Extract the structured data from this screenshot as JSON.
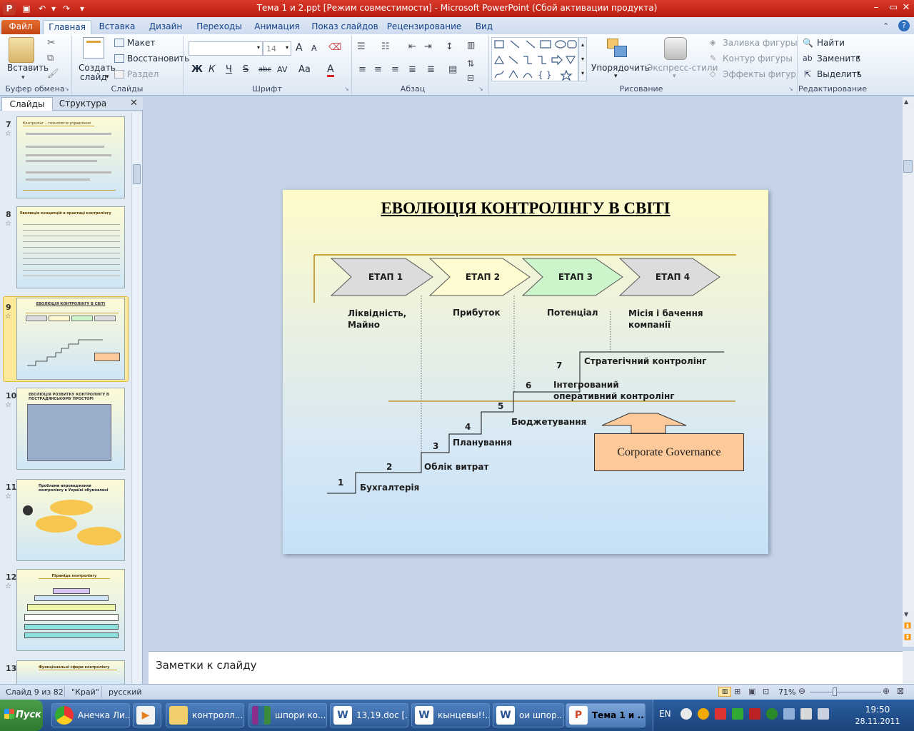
{
  "window": {
    "title": "Тема 1 и 2.ppt [Режим совместимости]  -  Microsoft PowerPoint (Сбой активации продукта)"
  },
  "ribbon_tabs": [
    "Файл",
    "Главная",
    "Вставка",
    "Дизайн",
    "Переходы",
    "Анимация",
    "Показ слайдов",
    "Рецензирование",
    "Вид"
  ],
  "ribbon": {
    "clipboard": {
      "paste": "Вставить",
      "group": "Буфер обмена"
    },
    "slides": {
      "new_slide_1": "Создать",
      "new_slide_2": "слайд",
      "layout": "Макет",
      "reset": "Восстановить",
      "section": "Раздел",
      "group": "Слайды"
    },
    "font": {
      "size": "14",
      "group": "Шрифт",
      "bold": "Ж",
      "italic": "К",
      "underline": "Ч",
      "strike": "S",
      "shadow": "abc",
      "spacing": "AV",
      "case": "Aa",
      "color": "A",
      "grow": "A",
      "shrink": "A"
    },
    "paragraph": {
      "group": "Абзац"
    },
    "drawing": {
      "arrange": "Упорядочить",
      "quick_styles": "Экспресс-стили",
      "fill": "Заливка фигуры",
      "outline": "Контур фигуры",
      "effects": "Эффекты фигур",
      "group": "Рисование"
    },
    "editing": {
      "find": "Найти",
      "replace": "Заменить",
      "select": "Выделить",
      "group": "Редактирование"
    }
  },
  "left_pane": {
    "tab_slides": "Слайды",
    "tab_outline": "Структура",
    "thumbnails": [
      {
        "num": "7",
        "title": "Контролінг – технологія управління",
        "selected": false
      },
      {
        "num": "8",
        "title": "Еволюція концепцій в практиці контролінгу",
        "selected": false
      },
      {
        "num": "9",
        "title": "ЕВОЛЮЦІЯ КОНТРОЛІНГУ В СВІТІ",
        "selected": true
      },
      {
        "num": "10",
        "title": "ЕВОЛЮЦІЯ РОЗВИТКУ КОНТРОЛІНГУ В ПОСТРАДЯНСЬКОМУ ПРОСТОРІ",
        "selected": false
      },
      {
        "num": "11",
        "title": "Проблеми впровадження контролінгу в Україні обумовлені",
        "selected": false
      },
      {
        "num": "12",
        "title": "Піраміда контролінгу",
        "selected": false
      },
      {
        "num": "13",
        "title": "Функціональні сфери контролінгу",
        "selected": false
      }
    ]
  },
  "slide": {
    "title": "ЕВОЛЮЦІЯ КОНТРОЛІНГУ  В СВІТІ",
    "stages": [
      {
        "label": "ЕТАП 1",
        "fill": "#dcdcdc"
      },
      {
        "label": "ЕТАП 2",
        "fill": "#fdfbcf"
      },
      {
        "label": "ЕТАП 3",
        "fill": "#ccf5cc"
      },
      {
        "label": "ЕТАП 4",
        "fill": "#dcdcdc"
      }
    ],
    "stage_notes": [
      "Ліквідність,\nМайно",
      "Прибуток",
      "Потенціал",
      "Місія і бачення\nкомпанії"
    ],
    "steps": [
      {
        "num": "1",
        "label": "Бухгалтерія"
      },
      {
        "num": "2",
        "label": "Облік витрат"
      },
      {
        "num": "3",
        "label": "Планування"
      },
      {
        "num": "4",
        "label": "Бюджетування"
      },
      {
        "num": "5",
        "label": ""
      },
      {
        "num": "6",
        "label": "Інтегрований\nоперативний контролінг"
      },
      {
        "num": "7",
        "label": "Стратегічний контролінг"
      }
    ],
    "governance": "Corporate Governance"
  },
  "notes": {
    "placeholder": "Заметки к слайду"
  },
  "status": {
    "slide": "Слайд 9 из 82",
    "theme": "\"Край\"",
    "language": "русский",
    "zoom": "71%"
  },
  "taskbar": {
    "start": "Пуск",
    "items": [
      {
        "label": "Анечка Ли...",
        "icon": "chrome-icon",
        "active": false
      },
      {
        "label": "",
        "icon": "media-player-icon",
        "active": false
      },
      {
        "label": "контролл...",
        "icon": "folder-icon",
        "active": false
      },
      {
        "label": "шпори ко...",
        "icon": "winrar-icon",
        "active": false
      },
      {
        "label": "13,19.doc [...",
        "icon": "word-icon",
        "active": false
      },
      {
        "label": "кынцевы!!...",
        "icon": "word-icon",
        "active": false
      },
      {
        "label": "ои шпор...",
        "icon": "word-icon",
        "active": false
      },
      {
        "label": "Тема 1 и ...",
        "icon": "powerpoint-icon",
        "active": true
      }
    ],
    "lang": "EN",
    "time": "19:50",
    "date": "28.11.2011"
  },
  "colors": {
    "title_bar": "#c8281a",
    "accent_orange": "#d96a2b",
    "governance_fill": "#fcc99a"
  }
}
